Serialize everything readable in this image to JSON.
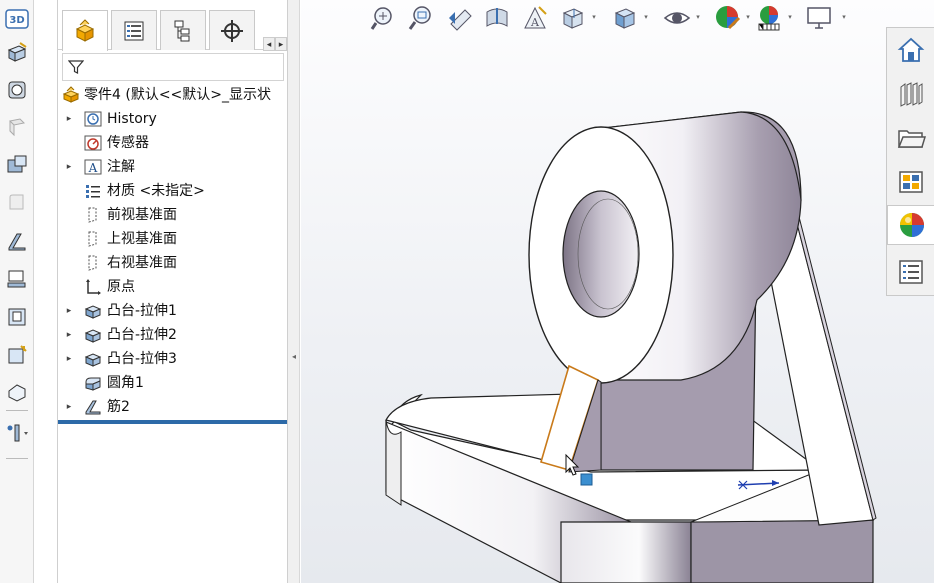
{
  "left_toolbar": {
    "badge_label": "3D",
    "tools": [
      "extruded-boss-icon",
      "revolved-boss-icon",
      "swept-boss-icon",
      "extruded-cut-icon",
      "fillet-icon",
      "rib-icon",
      "draft-icon",
      "shell-icon",
      "wrap-icon",
      "intersect-icon",
      "reference-geometry-icon"
    ]
  },
  "feature_manager": {
    "tabs": [
      "featuremanager-tab",
      "propertymanager-tab",
      "configurationmanager-tab",
      "dimxpert-tab"
    ],
    "filter_icon": "filter-icon",
    "items": [
      {
        "label": "零件4 (默认<<默认>_显示状",
        "icon": "part-icon",
        "expand": ""
      },
      {
        "label": "History",
        "icon": "history-icon",
        "expand": "▸"
      },
      {
        "label": "传感器",
        "icon": "sensor-icon",
        "expand": ""
      },
      {
        "label": "注解",
        "icon": "annotation-icon",
        "expand": "▸"
      },
      {
        "label": "材质 <未指定>",
        "icon": "material-icon",
        "expand": ""
      },
      {
        "label": "前视基准面",
        "icon": "plane-icon",
        "expand": ""
      },
      {
        "label": "上视基准面",
        "icon": "plane-icon",
        "expand": ""
      },
      {
        "label": "右视基准面",
        "icon": "plane-icon",
        "expand": ""
      },
      {
        "label": "原点",
        "icon": "origin-icon",
        "expand": ""
      },
      {
        "label": "凸台-拉伸1",
        "icon": "extrude-feature-icon",
        "expand": "▸"
      },
      {
        "label": "凸台-拉伸2",
        "icon": "extrude-feature-icon",
        "expand": "▸"
      },
      {
        "label": "凸台-拉伸3",
        "icon": "extrude-feature-icon",
        "expand": "▸"
      },
      {
        "label": "圆角1",
        "icon": "fillet-feature-icon",
        "expand": ""
      },
      {
        "label": "筋2",
        "icon": "rib-feature-icon",
        "expand": "▸"
      }
    ]
  },
  "heads_up_toolbar": {
    "tools": [
      "zoom-to-fit-icon",
      "zoom-to-area-icon",
      "previous-view-icon",
      "section-view-icon",
      "dynamic-annotation-icon",
      "view-orientation-icon",
      "display-style-icon",
      "hide-show-items-icon",
      "edit-appearance-icon",
      "apply-scene-icon",
      "view-settings-icon"
    ]
  },
  "task_pane": {
    "tools": [
      "solidworks-resources-icon",
      "design-library-icon",
      "file-explorer-icon",
      "view-palette-icon",
      "appearances-scenes-icon",
      "custom-properties-icon"
    ],
    "active_index": 4
  }
}
